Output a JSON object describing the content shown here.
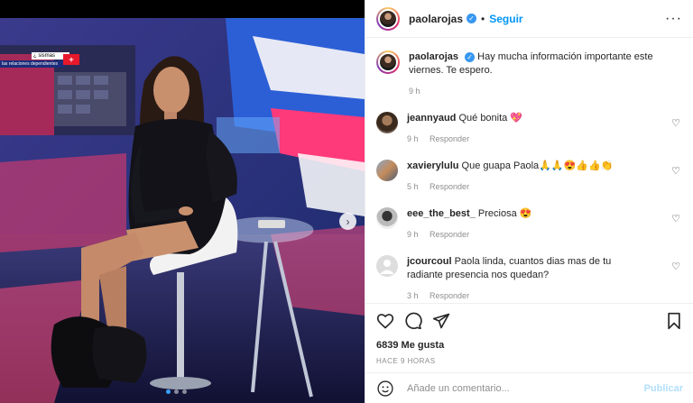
{
  "post": {
    "username": "paolarojas",
    "dot": "•",
    "follow_label": "Seguir",
    "more": "···",
    "photo_overlay": {
      "channel_badge": "+",
      "ticker_text": "¿ sismas",
      "ticker_sub": "las relaciones dependientes"
    },
    "slide_count": 3,
    "active_slide": 1
  },
  "caption": {
    "username": "paolarojas",
    "text": "Hay mucha información importante este viernes. Te espero.",
    "time": "9 h"
  },
  "comments": [
    {
      "username": "jeannyaud",
      "text": "Qué bonita 💖",
      "time": "9 h",
      "reply": "Responder"
    },
    {
      "username": "xavierylulu",
      "text": "Que guapa Paola🙏🙏😍👍👍👏",
      "time": "5 h",
      "reply": "Responder"
    },
    {
      "username": "eee_the_best_",
      "text": "Preciosa 😍",
      "time": "9 h",
      "reply": "Responder"
    },
    {
      "username": "jcourcoul",
      "text": "Paola linda, cuantos dias mas de tu radiante presencia nos quedan?",
      "time": "3 h",
      "reply": "Responder"
    }
  ],
  "stats": {
    "likes": "6839 Me gusta",
    "time_ago": "HACE 9 HORAS"
  },
  "add_comment": {
    "placeholder": "Añade un comentario...",
    "publish": "Publicar"
  },
  "icons": {
    "verified": "✓",
    "heart": "♡",
    "next": "›"
  }
}
